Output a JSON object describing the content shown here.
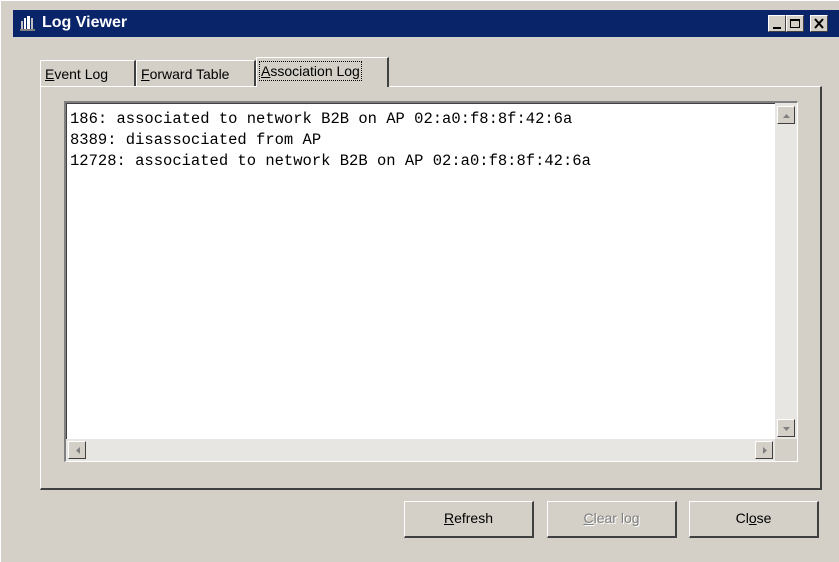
{
  "window": {
    "title": "Log Viewer",
    "icon": "network-app-icon"
  },
  "caption_buttons": [
    "minimize",
    "maximize",
    "close"
  ],
  "tabs": [
    {
      "label_prefix": "",
      "mnemonic": "E",
      "label_rest": "vent Log",
      "active": false
    },
    {
      "label_prefix": "",
      "mnemonic": "F",
      "label_rest": "orward Table",
      "active": false
    },
    {
      "label_prefix": "",
      "mnemonic": "A",
      "label_rest": "ssociation Log",
      "active": true
    }
  ],
  "log_lines": [
    "186: associated to network B2B on AP 02:a0:f8:8f:42:6a",
    "8389: disassociated from AP",
    "12728: associated to network B2B on AP 02:a0:f8:8f:42:6a"
  ],
  "buttons": {
    "refresh": {
      "mnemonic": "R",
      "rest": "efresh",
      "enabled": true
    },
    "clear_log": {
      "mnemonic": "C",
      "rest": "lear log",
      "enabled": false
    },
    "close": {
      "prefix": "Cl",
      "mnemonic": "o",
      "rest": "se",
      "enabled": true
    }
  },
  "colors": {
    "titlebar": "#0a246a",
    "face": "#d4d0c8"
  }
}
